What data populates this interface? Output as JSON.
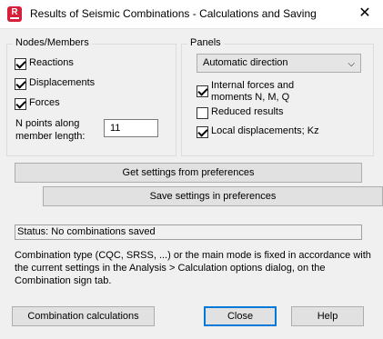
{
  "window": {
    "title": "Results of Seismic Combinations - Calculations and Saving",
    "app_icon": "R",
    "close_glyph": "✕"
  },
  "nodes_members": {
    "label": "Nodes/Members",
    "reactions": {
      "label": "Reactions",
      "checked": true
    },
    "displacements": {
      "label": "Displacements",
      "checked": true
    },
    "forces": {
      "label": "Forces",
      "checked": true
    },
    "n_points_label_1": "N points along",
    "n_points_label_2": "member length:",
    "n_points_value": "11"
  },
  "panels": {
    "label": "Panels",
    "direction_value": "Automatic direction",
    "internal_forces_1": "Internal forces and",
    "internal_forces_2": "moments N, M, Q",
    "internal_forces_checked": true,
    "reduced_results": {
      "label": "Reduced results",
      "checked": false
    },
    "local_displacements": {
      "label": "Local displacements; Kz",
      "checked": true
    }
  },
  "buttons": {
    "get_settings": "Get settings from preferences",
    "save_settings": "Save settings in preferences",
    "combination_calculations": "Combination calculations",
    "close": "Close",
    "help": "Help"
  },
  "status": "Status: No combinations saved",
  "note": "Combination type (CQC, SRSS, ...) or the main mode is fixed in accordance with the current settings in the Analysis > Calculation options dialog, on the Combination sign tab.",
  "colors": {
    "accent": "#0078d7",
    "app_icon": "#d6203a",
    "dialog_bg": "#f0f0f0"
  }
}
